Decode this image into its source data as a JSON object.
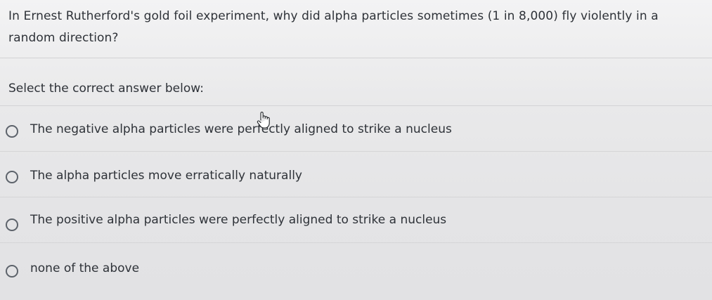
{
  "question": {
    "text": "In Ernest Rutherford's gold foil experiment, why did alpha particles sometimes (1 in 8,000) fly violently in a random direction?"
  },
  "instruction": "Select the correct answer below:",
  "options": [
    {
      "label": "The negative alpha particles were perfectly aligned to strike a nucleus",
      "selected": false
    },
    {
      "label": "The alpha particles move erratically naturally",
      "selected": false
    },
    {
      "label": "The positive alpha particles were perfectly aligned to strike a nucleus",
      "selected": false
    },
    {
      "label": "none of the above",
      "selected": false
    }
  ],
  "colors": {
    "text": "#2e3238",
    "radio_border": "#5d636b",
    "divider": "#d3d3d5"
  },
  "icons": {
    "cursor": "hand-pointer-icon",
    "radio": "radio-circle-icon"
  }
}
